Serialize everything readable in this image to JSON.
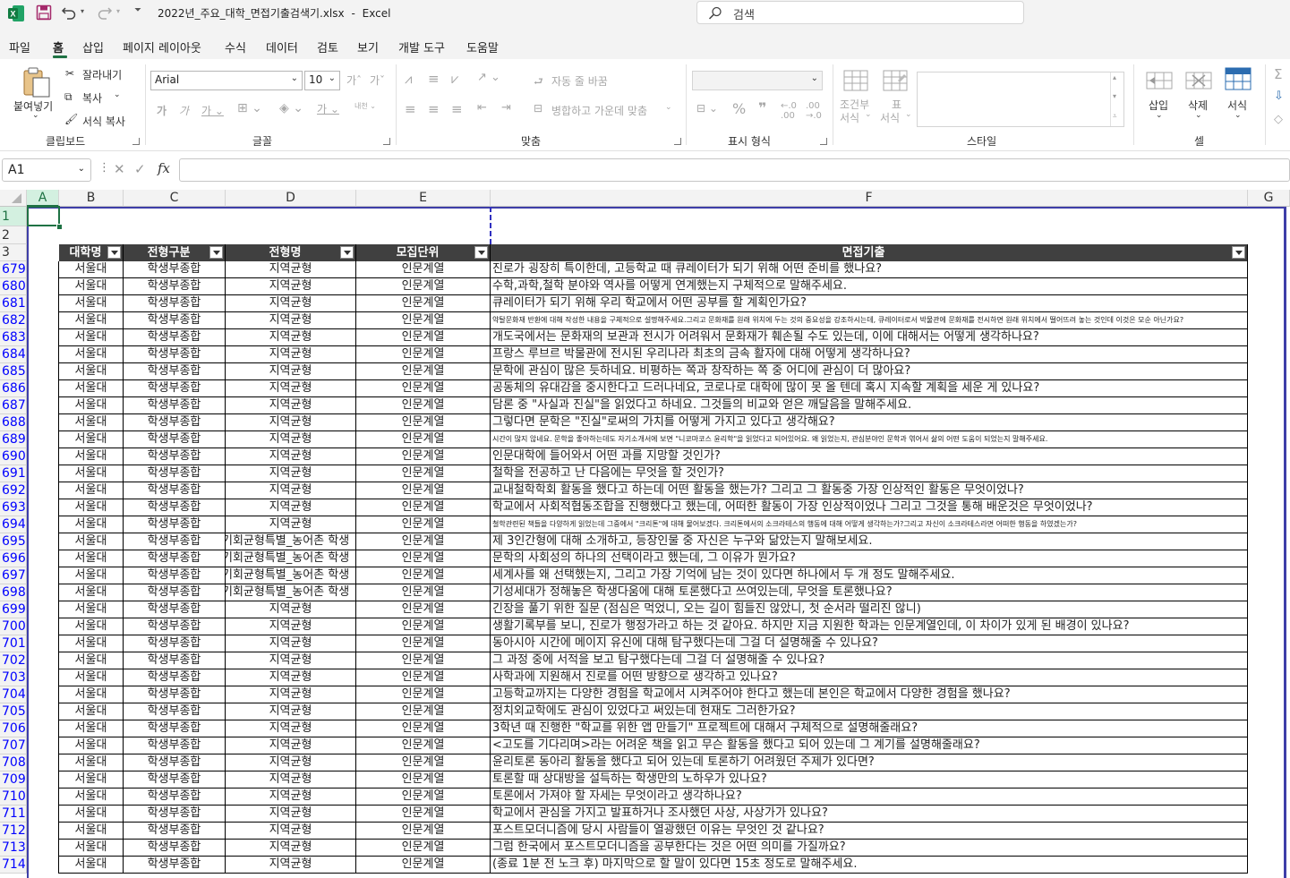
{
  "titlebar": {
    "filename": "2022년_주요_대학_면접기출검색기.xlsx",
    "separator": "-",
    "app": "Excel",
    "search_placeholder": "검색"
  },
  "menu": {
    "file": "파일",
    "home": "홈",
    "insert": "삽입",
    "page_layout": "페이지 레이아웃",
    "formulas": "수식",
    "data": "데이터",
    "review": "검토",
    "view": "보기",
    "developer": "개발 도구",
    "help": "도움말"
  },
  "ribbon": {
    "paste": "붙여넣기",
    "cut": "잘라내기",
    "copy": "복사",
    "format_painter": "서식 복사",
    "clipboard": "클립보드",
    "font_name": "Arial",
    "font_size": "10",
    "font_group": "글꼴",
    "wrap_text": "자동 줄 바꿈",
    "merge_center": "병합하고 가운데 맞춤",
    "alignment_group": "맞춤",
    "number_group": "표시 형식",
    "cond_format_1": "조건부",
    "cond_format_2": "서식",
    "table_1": "표",
    "table_2": "서식",
    "style_group": "스타일",
    "insert": "삽입",
    "delete": "삭제",
    "format": "서식",
    "cells_group": "셀"
  },
  "formula": {
    "name_box": "A1",
    "fx": "fx",
    "content": ""
  },
  "columns": [
    "A",
    "B",
    "C",
    "D",
    "E",
    "F",
    "G"
  ],
  "top_rows": [
    "1",
    "2",
    "3"
  ],
  "headers": {
    "university": "대학명",
    "type": "전형구분",
    "name": "전형명",
    "unit": "모집단위",
    "question": "면접기출"
  },
  "rows": [
    {
      "n": "679",
      "u": "서울대",
      "t": "학생부종합",
      "nm": "지역균형",
      "unit": "인문계열",
      "q": "진로가 굉장히 특이한데, 고등학교 때 큐레이터가 되기 위해 어떤 준비를 했나요?"
    },
    {
      "n": "680",
      "u": "서울대",
      "t": "학생부종합",
      "nm": "지역균형",
      "unit": "인문계열",
      "q": "수학,과학,철학 분야와 역사를 어떻게 연계했는지 구체적으로 말해주세요."
    },
    {
      "n": "681",
      "u": "서울대",
      "t": "학생부종합",
      "nm": "지역균형",
      "unit": "인문계열",
      "q": "큐레이터가 되기 위해 우리 학교에서 어떤 공부를 할 계획인가요?"
    },
    {
      "n": "682",
      "u": "서울대",
      "t": "학생부종합",
      "nm": "지역균형",
      "unit": "인문계열",
      "q": "약탈문화재 반환에 대해 작성한 내용을 구체적으로 설명해주세요.그리고 문화재를 원래 위치에 두는 것의 중요성을 강조하시는데, 큐레이터로서 박물관에 문화재를 전시하면 원래 위치에서 떨어뜨려 놓는 것인데 이것은 모순 아닌가요?"
    },
    {
      "n": "683",
      "u": "서울대",
      "t": "학생부종합",
      "nm": "지역균형",
      "unit": "인문계열",
      "q": "개도국에서는 문화재의 보관과 전시가 어려워서 문화재가 훼손될 수도 있는데, 이에 대해서는 어떻게 생각하나요?"
    },
    {
      "n": "684",
      "u": "서울대",
      "t": "학생부종합",
      "nm": "지역균형",
      "unit": "인문계열",
      "q": "프랑스 루브르 박물관에 전시된 우리나라 최초의 금속 활자에 대해 어떻게 생각하나요?"
    },
    {
      "n": "685",
      "u": "서울대",
      "t": "학생부종합",
      "nm": "지역균형",
      "unit": "인문계열",
      "q": "문학에 관심이 많은 듯하네요. 비평하는 쪽과 창작하는 쪽 중 어디에 관심이 더 많아요?"
    },
    {
      "n": "686",
      "u": "서울대",
      "t": "학생부종합",
      "nm": "지역균형",
      "unit": "인문계열",
      "q": "공동체의 유대감을 중시한다고 드러나네요, 코로나로 대학에 많이 못 올 텐데 혹시 지속할 계획을 세운 게 있나요?"
    },
    {
      "n": "687",
      "u": "서울대",
      "t": "학생부종합",
      "nm": "지역균형",
      "unit": "인문계열",
      "q": "담론 중 \"사실과 진실\"을 읽었다고 하네요. 그것들의 비교와 얻은 깨달음을 말해주세요."
    },
    {
      "n": "688",
      "u": "서울대",
      "t": "학생부종합",
      "nm": "지역균형",
      "unit": "인문계열",
      "q": "그렇다면 문학은 \"진실\"로써의 가치를 어떻게 가지고 있다고 생각해요?"
    },
    {
      "n": "689",
      "u": "서울대",
      "t": "학생부종합",
      "nm": "지역균형",
      "unit": "인문계열",
      "q": "시간이 많지 않네요. 문학을 좋아하는데도 자기소개서에 보면 \"니코마코스 윤리학\"을 읽었다고 되어있어요. 왜 읽었는지, 관심분야인 문학과 엮어서 삶의 어떤 도움이 되었는지 말해주세요."
    },
    {
      "n": "690",
      "u": "서울대",
      "t": "학생부종합",
      "nm": "지역균형",
      "unit": "인문계열",
      "q": "인문대학에 들어와서 어떤 과를 지망할 것인가?"
    },
    {
      "n": "691",
      "u": "서울대",
      "t": "학생부종합",
      "nm": "지역균형",
      "unit": "인문계열",
      "q": "철학을 전공하고 난 다음에는 무엇을 할 것인가?"
    },
    {
      "n": "692",
      "u": "서울대",
      "t": "학생부종합",
      "nm": "지역균형",
      "unit": "인문계열",
      "q": "교내철학학회 활동을 했다고 하는데 어떤 활동을 했는가? 그리고 그 활동중 가장 인상적인 활동은 무엇이었나?"
    },
    {
      "n": "693",
      "u": "서울대",
      "t": "학생부종합",
      "nm": "지역균형",
      "unit": "인문계열",
      "q": "학교에서 사회적협동조합을 진행했다고 했는데, 어떠한 활동이 가장 인상적이었나 그리고 그것을 통해 배운것은 무엇이었나?"
    },
    {
      "n": "694",
      "u": "서울대",
      "t": "학생부종합",
      "nm": "지역균형",
      "unit": "인문계열",
      "q": "철학관련된 책들을 다양하게 읽었는데 그중에서 \"크리톤\"에 대해 물어보겠다. 크리톤에서의 소크라테스의 행동에 대해 어떻게 생각하는가?그리고 자신이 소크라테스라면 어떠한 행동을 하였겠는가?"
    },
    {
      "n": "695",
      "u": "서울대",
      "t": "학생부종합",
      "nm": "기회균형특별_농어촌 학생",
      "unit": "인문계열",
      "q": "제 3인간형에 대해 소개하고, 등장인물 중 자신은 누구와 닮았는지 말해보세요."
    },
    {
      "n": "696",
      "u": "서울대",
      "t": "학생부종합",
      "nm": "기회균형특별_농어촌 학생",
      "unit": "인문계열",
      "q": "문학의 사회성의 하나의 선택이라고 했는데, 그 이유가 뭔가요?"
    },
    {
      "n": "697",
      "u": "서울대",
      "t": "학생부종합",
      "nm": "기회균형특별_농어촌 학생",
      "unit": "인문계열",
      "q": "세계사를 왜 선택했는지, 그리고 가장 기억에 남는 것이 있다면 하나에서 두 개 정도 말해주세요."
    },
    {
      "n": "698",
      "u": "서울대",
      "t": "학생부종합",
      "nm": "기회균형특별_농어촌 학생",
      "unit": "인문계열",
      "q": "기성세대가 정해놓은 학생다움에 대해 토론했다고 쓰여있는데, 무엇을 토론했나요?"
    },
    {
      "n": "699",
      "u": "서울대",
      "t": "학생부종합",
      "nm": "지역균형",
      "unit": "인문계열",
      "q": "긴장을 풀기 위한 질문 (점심은 먹었니, 오는 길이 힘들진 않았니, 첫 순서라 떨리진 않니)"
    },
    {
      "n": "700",
      "u": "서울대",
      "t": "학생부종합",
      "nm": "지역균형",
      "unit": "인문계열",
      "q": "생활기록부를 보니, 진로가 행정가라고 하는 것 같아요. 하지만 지금 지원한 학과는 인문계열인데, 이 차이가 있게 된 배경이 있나요?"
    },
    {
      "n": "701",
      "u": "서울대",
      "t": "학생부종합",
      "nm": "지역균형",
      "unit": "인문계열",
      "q": "동아시아 시간에 메이지 유신에 대해 탐구했다는데 그걸 더 설명해줄 수 있나요?"
    },
    {
      "n": "702",
      "u": "서울대",
      "t": "학생부종합",
      "nm": "지역균형",
      "unit": "인문계열",
      "q": "그 과정 중에 서적을 보고 탐구했다는데 그걸 더 설명해줄 수 있나요?"
    },
    {
      "n": "703",
      "u": "서울대",
      "t": "학생부종합",
      "nm": "지역균형",
      "unit": "인문계열",
      "q": "사학과에 지원해서 진로를 어떤 방향으로 생각하고 있나요?"
    },
    {
      "n": "704",
      "u": "서울대",
      "t": "학생부종합",
      "nm": "지역균형",
      "unit": "인문계열",
      "q": "고등학교까지는 다양한 경험을 학교에서 시켜주어야 한다고 했는데 본인은 학교에서 다양한 경험을 했나요?"
    },
    {
      "n": "705",
      "u": "서울대",
      "t": "학생부종합",
      "nm": "지역균형",
      "unit": "인문계열",
      "q": "정치외교학에도 관심이 있었다고 써있는데 현재도 그러한가요?"
    },
    {
      "n": "706",
      "u": "서울대",
      "t": "학생부종합",
      "nm": "지역균형",
      "unit": "인문계열",
      "q": "3학년 때 진행한 \"학교를 위한 앱 만들기\" 프로젝트에 대해서 구체적으로 설명해줄래요?"
    },
    {
      "n": "707",
      "u": "서울대",
      "t": "학생부종합",
      "nm": "지역균형",
      "unit": "인문계열",
      "q": "<고도를 기다리며>라는 어려운 책을 읽고 무슨 활동을 했다고 되어 있는데 그 계기를 설명해줄래요?"
    },
    {
      "n": "708",
      "u": "서울대",
      "t": "학생부종합",
      "nm": "지역균형",
      "unit": "인문계열",
      "q": "윤리토론 동아리 활동을 했다고 되어 있는데 토론하기 어려웠던 주제가 있다면?"
    },
    {
      "n": "709",
      "u": "서울대",
      "t": "학생부종합",
      "nm": "지역균형",
      "unit": "인문계열",
      "q": "토론할 때 상대방을 설득하는 학생만의 노하우가 있나요?"
    },
    {
      "n": "710",
      "u": "서울대",
      "t": "학생부종합",
      "nm": "지역균형",
      "unit": "인문계열",
      "q": "토론에서 가져야 할 자세는 무엇이라고 생각하나요?"
    },
    {
      "n": "711",
      "u": "서울대",
      "t": "학생부종합",
      "nm": "지역균형",
      "unit": "인문계열",
      "q": "학교에서 관심을 가지고 발표하거나 조사했던 사상, 사상가가 있나요?"
    },
    {
      "n": "712",
      "u": "서울대",
      "t": "학생부종합",
      "nm": "지역균형",
      "unit": "인문계열",
      "q": "포스트모더니즘에 당시 사람들이 열광했던 이유는 무엇인 것 같나요?"
    },
    {
      "n": "713",
      "u": "서울대",
      "t": "학생부종합",
      "nm": "지역균형",
      "unit": "인문계열",
      "q": "그럼 한국에서 포스트모더니즘을 공부한다는 것은 어떤 의미를 가질까요?"
    },
    {
      "n": "714",
      "u": "서울대",
      "t": "학생부종합",
      "nm": "지역균형",
      "unit": "인문계열",
      "q": "(종료 1분 전 노크 후) 마지막으로 할 말이 있다면 15초 정도로 말해주세요."
    }
  ],
  "colors": {
    "accent": "#1f7244",
    "header_bg": "#404040",
    "filter_row_number": "#0000ff"
  }
}
